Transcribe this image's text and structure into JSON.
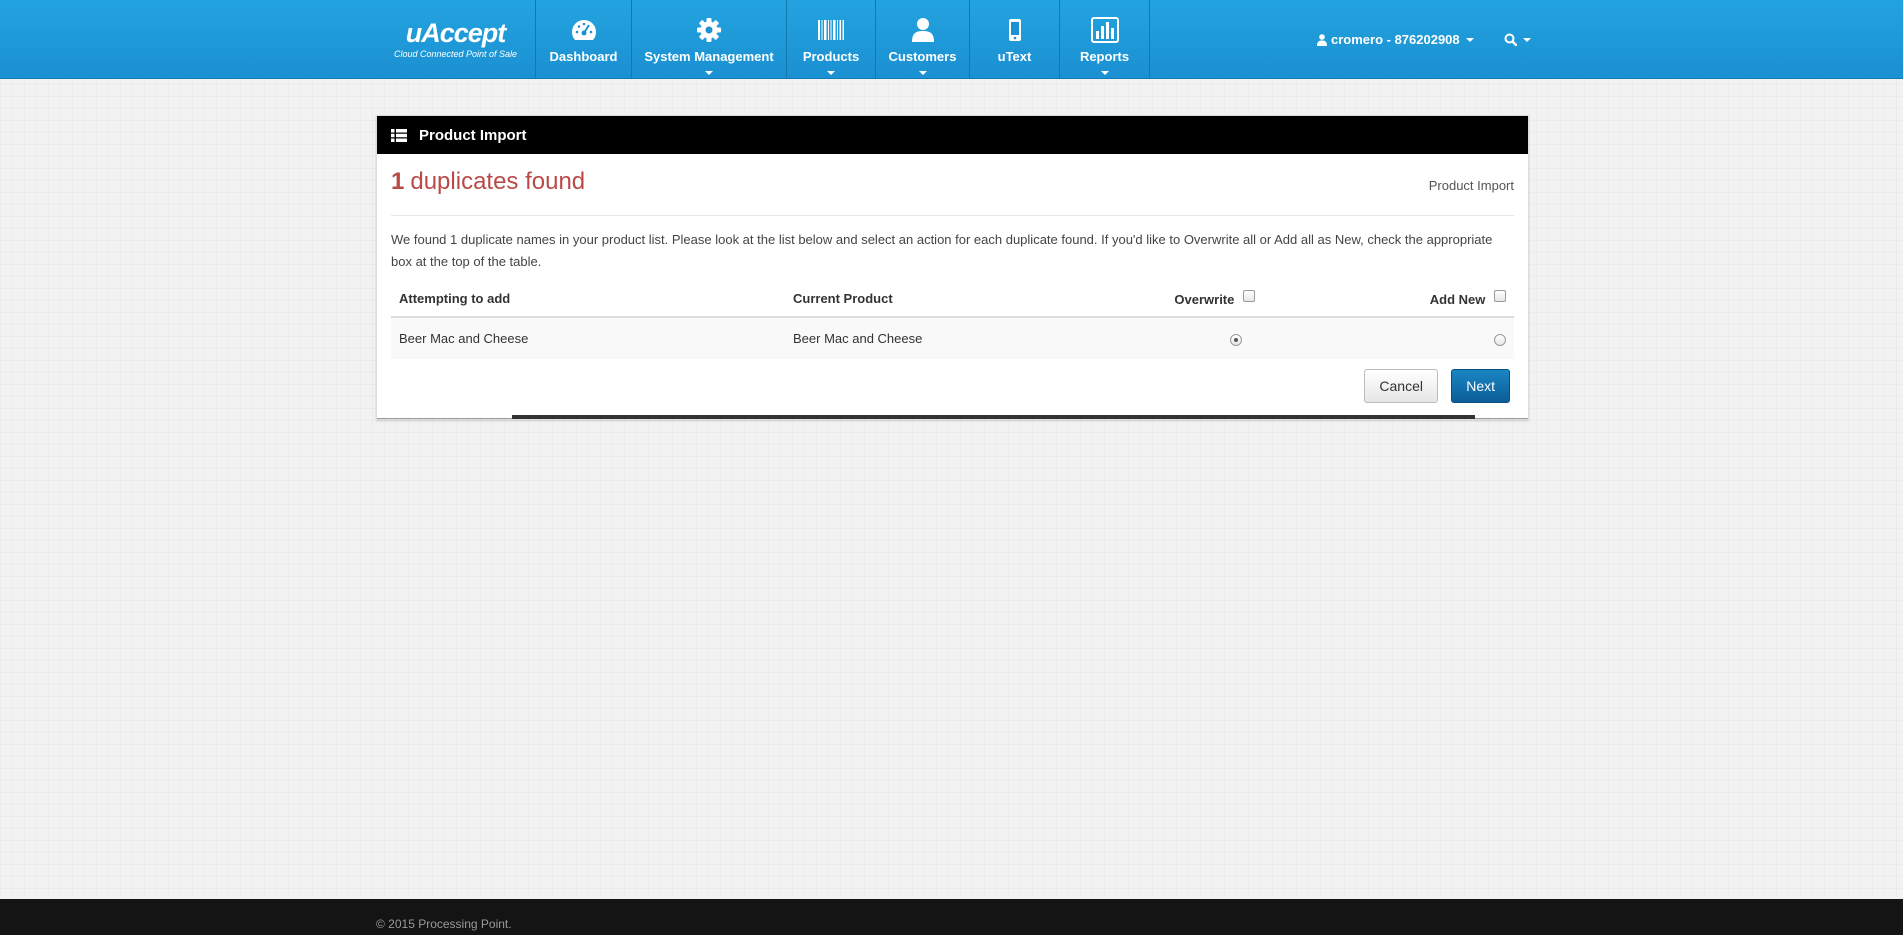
{
  "app": {
    "logo_text": "uAccept",
    "logo_tagline": "Cloud Connected Point of Sale"
  },
  "nav": {
    "items": [
      {
        "label": "Dashboard",
        "icon": "dashboard-gauge-icon",
        "has_dropdown": false
      },
      {
        "label": "System Management",
        "icon": "gear-icon",
        "has_dropdown": true
      },
      {
        "label": "Products",
        "icon": "barcode-icon",
        "has_dropdown": true
      },
      {
        "label": "Customers",
        "icon": "user-icon",
        "has_dropdown": true
      },
      {
        "label": "uText",
        "icon": "mobile-phone-icon",
        "has_dropdown": false
      },
      {
        "label": "Reports",
        "icon": "bar-chart-icon",
        "has_dropdown": true
      }
    ],
    "user_label": "cromero - 876202908"
  },
  "panel": {
    "heading": "Product Import",
    "count": "1",
    "title_rest": "duplicates found",
    "breadcrumb": "Product Import",
    "description": "We found 1 duplicate names in your product list. Please look at the list below and select an action for each duplicate found. If you'd like to Overwrite all or Add all as New, check the appropriate box at the top of the table."
  },
  "table": {
    "headers": {
      "attempting": "Attempting to add",
      "current": "Current Product",
      "overwrite": "Overwrite",
      "add_new": "Add New"
    },
    "rows": [
      {
        "attempting": "Beer Mac and Cheese",
        "current": "Beer Mac and Cheese",
        "selected": "overwrite"
      }
    ]
  },
  "buttons": {
    "cancel": "Cancel",
    "next": "Next"
  },
  "footer": {
    "text": "© 2015 Processing Point."
  },
  "colors": {
    "navbar": "#1b90d2",
    "title_red": "#b94a48",
    "next_button": "#0c5d97"
  }
}
